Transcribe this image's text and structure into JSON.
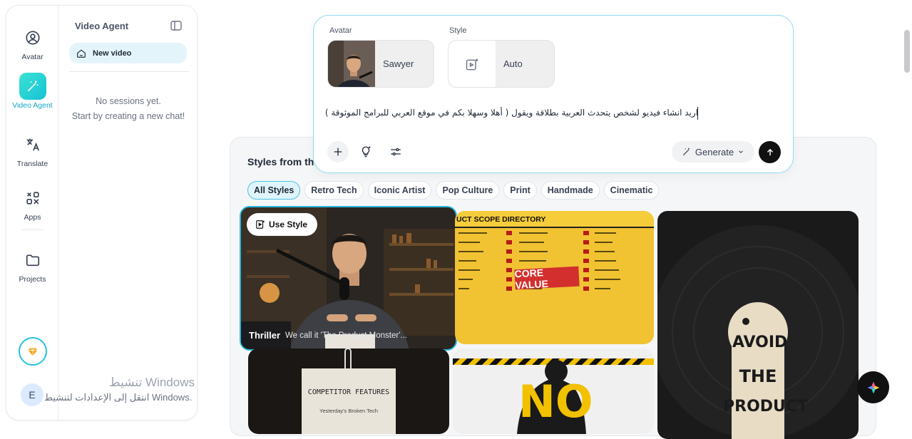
{
  "rail": {
    "items": [
      {
        "label": "Avatar",
        "icon": "avatar-icon"
      },
      {
        "label": "Video Agent",
        "icon": "wand-icon"
      },
      {
        "label": "Translate",
        "icon": "translate-icon"
      },
      {
        "label": "Apps",
        "icon": "apps-icon"
      },
      {
        "label": "Projects",
        "icon": "folder-icon"
      }
    ],
    "user_initial": "E",
    "accent": "#1cc6d8"
  },
  "panel": {
    "title": "Video Agent",
    "new_video": "New video",
    "empty_title": "No sessions yet.",
    "empty_sub": "Start by creating a new chat!"
  },
  "composer": {
    "avatar_caption": "Avatar",
    "avatar_name": "Sawyer",
    "style_caption": "Style",
    "style_name": "Auto",
    "prompt": "اريد انشاء فيديو لشخص يتحدث العربية بطلاقة ويقول ( أهلا وسهلا بكم في موقع العربي للبرامج الموثوقة )",
    "generate_label": "Generate"
  },
  "gallery": {
    "title": "Styles from th",
    "chips": [
      "All Styles",
      "Retro Tech",
      "Iconic Artist",
      "Pop Culture",
      "Print",
      "Handmade",
      "Cinematic"
    ],
    "use_style": "Use Style",
    "tile1_tag": "Thriller",
    "tile1_caption": "We call it 'The Product Monster'...",
    "tile2_header": "UCT SCOPE DIRECTORY",
    "tile2_stamp": "CORE VALUE",
    "tile3_words": [
      "AVOID",
      "THE",
      "PRODUCT"
    ],
    "tile4_title": "COMPETITOR FEATURES",
    "tile4_sub": "Yesterday's Broken Tech",
    "tile5_word": "NO"
  },
  "watermark": {
    "title": "تنشيط Windows",
    "sub": "انتقل إلى الإعدادات لتنشيط Windows."
  }
}
